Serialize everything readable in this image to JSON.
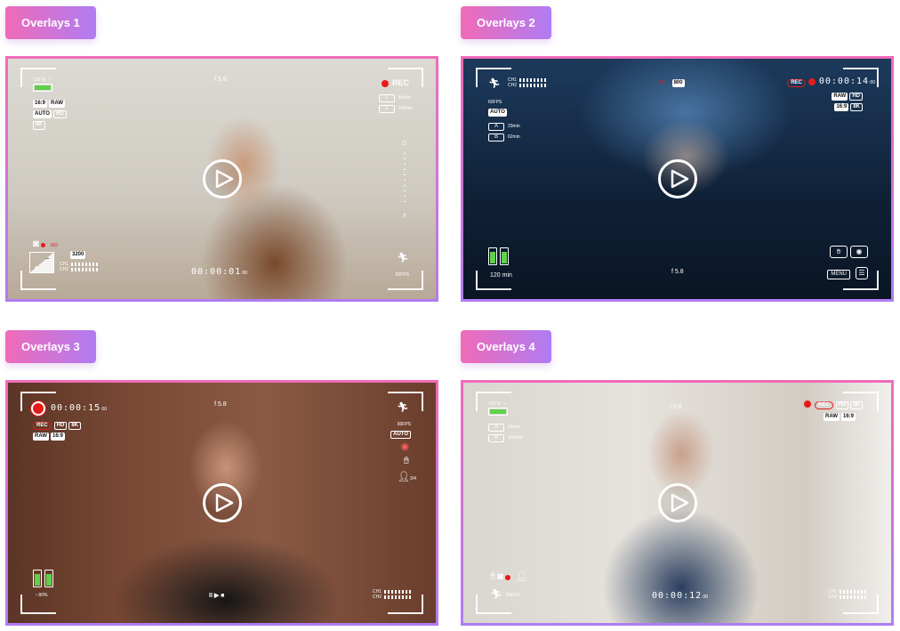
{
  "cards": [
    {
      "title": "Overlays 1",
      "fstop": "f 5.8",
      "battery": "100 %",
      "chips": [
        "16:9",
        "RAW",
        "AUTO",
        "HD",
        "8K"
      ],
      "rec_label": "REC",
      "slots": [
        {
          "num": "1",
          "text": "59min"
        },
        {
          "num": "2",
          "text": "100min"
        }
      ],
      "iso_label": "ISO",
      "iso_value": "3200",
      "channels": [
        "CH1",
        "CH2"
      ],
      "timecode": "00:00:01",
      "timecode_frames": "00",
      "fps": "60FPS"
    },
    {
      "title": "Overlays 2",
      "channels": [
        "CH1",
        "CH2"
      ],
      "iso_label": "ISO",
      "iso_value": "800",
      "rec_label": "REC",
      "timecode": "00:00:14",
      "timecode_frames": "00",
      "fps": "60FPS",
      "auto": "AUTO",
      "slots": [
        {
          "num": "A",
          "text": "23min"
        },
        {
          "num": "B",
          "text": "62min"
        }
      ],
      "chips": [
        "RAW",
        "HD",
        "16:9",
        "8K"
      ],
      "battery_time": "120 min",
      "fstop": "f 5.8",
      "menu": "MENU"
    },
    {
      "title": "Overlays 3",
      "timecode": "00:00:15",
      "timecode_frames": "00",
      "rec_label": "REC",
      "chips": [
        "HD",
        "8K",
        "RAW",
        "16:9"
      ],
      "fstop": "f 5.8",
      "fps": "60FPS",
      "auto": "AUTO",
      "person_count": "3/4",
      "wifi": "80%",
      "transport": "II ▶ ■",
      "channels": [
        "CH1",
        "CH2"
      ]
    },
    {
      "title": "Overlays 4",
      "battery": "100 %",
      "slots": [
        {
          "num": "A",
          "text": "59min"
        },
        {
          "num": "B",
          "text": "100min"
        }
      ],
      "fstop": "f 5.8",
      "rec_label": "REC",
      "chips": [
        "HD",
        "8K",
        "RAW",
        "16:9"
      ],
      "fps": "60FPS",
      "timecode": "00:00:12",
      "timecode_frames": "00",
      "channels": [
        "CH1",
        "CH2"
      ]
    }
  ],
  "colors": {
    "badge_start": "#f06bb8",
    "badge_end": "#b07cf3",
    "rec_red": "#e51b1b",
    "battery_green": "#5fd14b"
  },
  "icons": [
    "play-icon",
    "rec-dot-icon",
    "battery-icon",
    "wifi-icon",
    "running-person-icon",
    "hand-icon",
    "eye-icon",
    "camera-icon",
    "light-bulb-icon",
    "person-icon",
    "exposure-icon"
  ]
}
